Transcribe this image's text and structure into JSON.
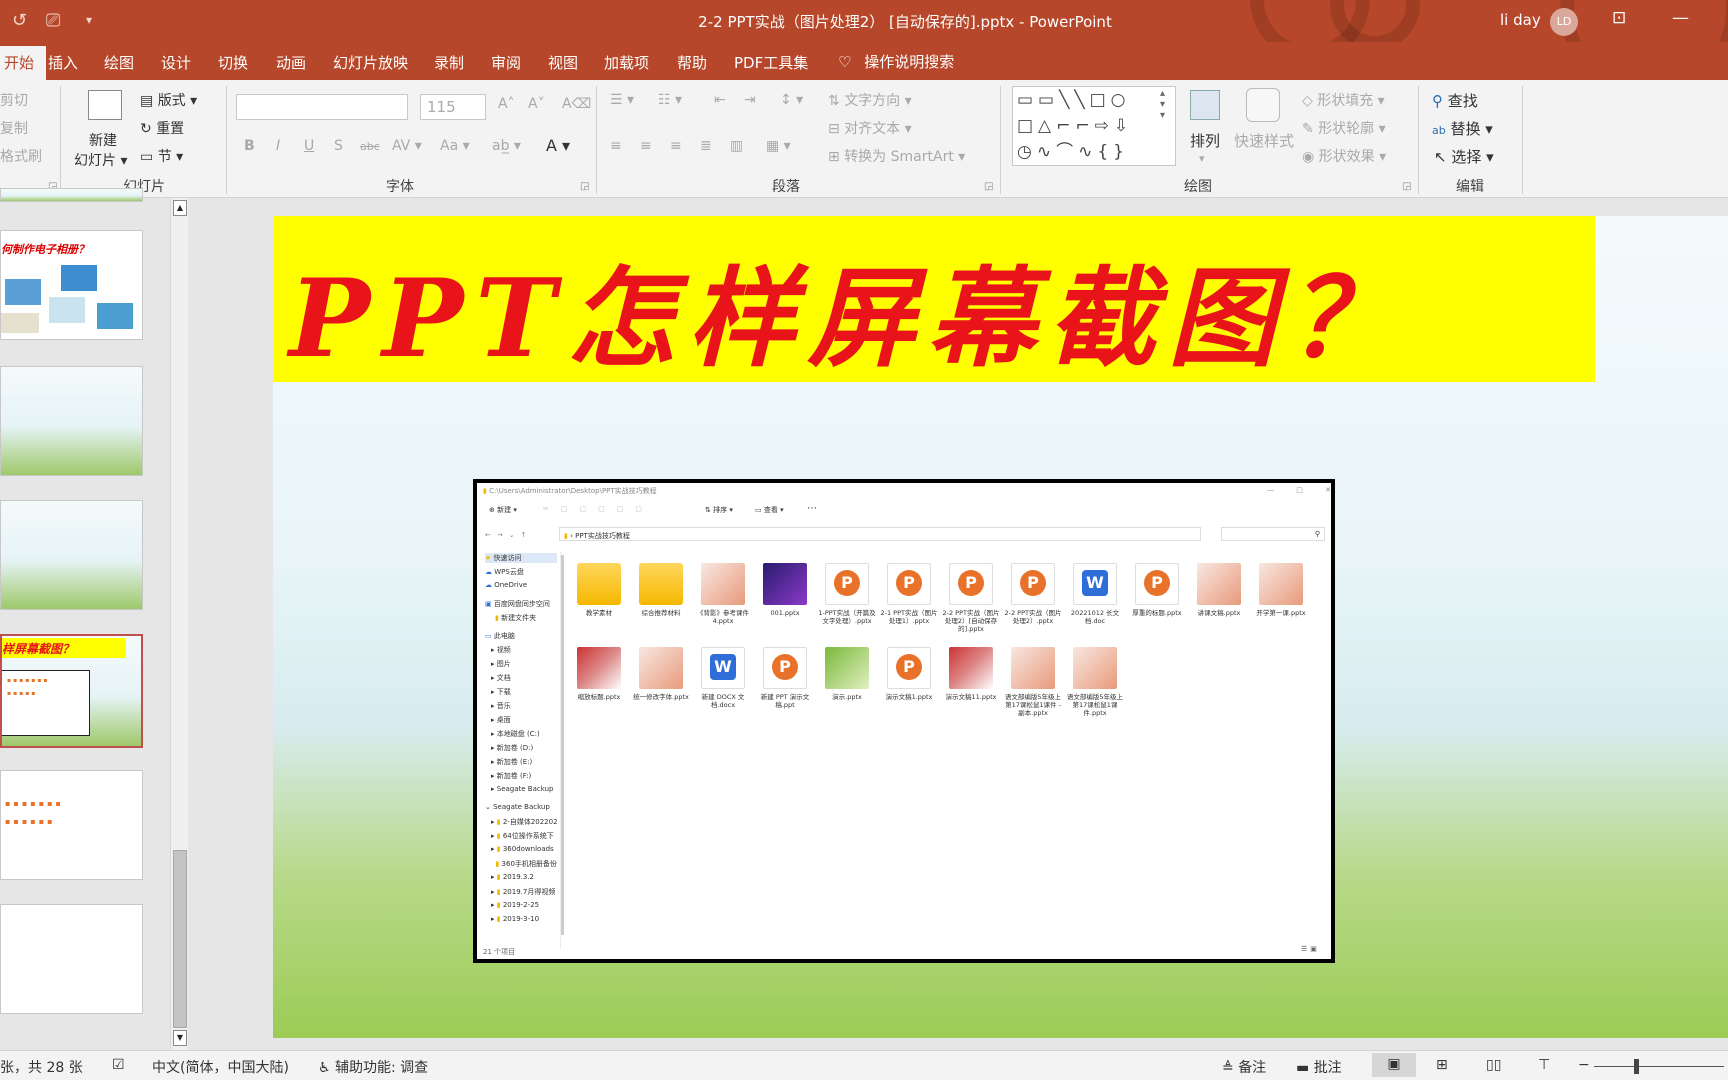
{
  "window": {
    "title": "2-2 PPT实战（图片处理2）  [自动保存的].pptx  -  PowerPoint",
    "user_name": "li day",
    "user_initials": "LD",
    "accent": "#b7472a"
  },
  "tabs": [
    "开始",
    "插入",
    "绘图",
    "设计",
    "切换",
    "动画",
    "幻灯片放映",
    "录制",
    "审阅",
    "视图",
    "加载项",
    "帮助",
    "PDF工具集"
  ],
  "tell_me": "操作说明搜索",
  "ribbon": {
    "clipboard": {
      "cut": "剪切",
      "copy": "复制",
      "format_painter": "格式刷"
    },
    "slides": {
      "new_slide_line1": "新建",
      "new_slide_line2": "幻灯片",
      "layout": "版式",
      "reset": "重置",
      "section": "节",
      "group": "幻灯片"
    },
    "font": {
      "size": "115",
      "group": "字体",
      "bold": "B",
      "italic": "I",
      "underline": "U",
      "shadow": "S",
      "strike": "abc",
      "spacing": "AV",
      "case": "Aa"
    },
    "paragraph": {
      "text_direction": "文字方向",
      "align_text": "对齐文本",
      "smartart": "转换为 SmartArt",
      "group": "段落"
    },
    "drawing": {
      "arrange": "排列",
      "quick_styles": "快速样式",
      "shape_fill": "形状填充",
      "shape_outline": "形状轮廓",
      "shape_effects": "形状效果",
      "group": "绘图"
    },
    "editing": {
      "find": "查找",
      "replace": "替换",
      "select": "选择",
      "group": "编辑"
    }
  },
  "thumbnails": [
    {
      "caption": "何制作电子相册？"
    },
    {
      "caption": ""
    },
    {
      "caption": ""
    },
    {
      "caption": "样屏幕截图？"
    },
    {
      "caption": ""
    },
    {
      "caption": ""
    }
  ],
  "slide": {
    "banner_text": "PPT怎样屏幕截图？",
    "explorer": {
      "title_path": "C:\\Users\\Administrator\\Desktop\\PPT实战技巧教程",
      "toolbar": {
        "new": "新建",
        "sort": "排序",
        "view": "查看"
      },
      "address": "PPT实战技巧教程",
      "sidebar": [
        "快速访问",
        "WPS云盘",
        "OneDrive",
        "百度网盘同步空间",
        "新建文件夹",
        "此电脑",
        "视频",
        "图片",
        "文档",
        "下载",
        "音乐",
        "桌面",
        "本地磁盘 (C:)",
        "新加卷 (D:)",
        "新加卷 (E:)",
        "新加卷 (F:)",
        "Seagate Backup",
        "Seagate Backup",
        "2-自媒体202202",
        "64位操作系统下",
        "360downloads",
        "360手机相册备份",
        "2019.3.2",
        "2019.7月得视频",
        "2019-2-25",
        "2019-3-10"
      ],
      "item_count": "21 个项目",
      "files_row1": [
        {
          "name": "教学素材",
          "kind": "folder"
        },
        {
          "name": "综合推荐材料",
          "kind": "folder"
        },
        {
          "name": "《背影》参考课件4.pptx",
          "kind": "img4"
        },
        {
          "name": "001.pptx",
          "kind": "img2"
        },
        {
          "name": "1-PPT实战（开篇及文字处理）.pptx",
          "kind": "ppt"
        },
        {
          "name": "2-1 PPT实战（图片处理1）.pptx",
          "kind": "ppt"
        },
        {
          "name": "2-2 PPT实战（图片处理2）[自动保存的].pptx",
          "kind": "ppt"
        },
        {
          "name": "2-2 PPT实战（图片处理2）.pptx",
          "kind": "ppt"
        },
        {
          "name": "20221012 长文档.doc",
          "kind": "word"
        },
        {
          "name": "厚重的标题.pptx",
          "kind": "ppt"
        },
        {
          "name": "讲课文稿.pptx",
          "kind": "img4"
        },
        {
          "name": "开学第一课.pptx",
          "kind": "img4"
        }
      ],
      "files_row2": [
        {
          "name": "缩放标题.pptx",
          "kind": "img"
        },
        {
          "name": "统一修改字体.pptx",
          "kind": "img4"
        },
        {
          "name": "新建 DOCX 文档.docx",
          "kind": "word"
        },
        {
          "name": "新建 PPT 演示文稿.ppt",
          "kind": "ppt"
        },
        {
          "name": "演示.pptx",
          "kind": "img3"
        },
        {
          "name": "演示文稿1.pptx",
          "kind": "ppt"
        },
        {
          "name": "演示文稿11.pptx",
          "kind": "img"
        },
        {
          "name": "语文部编版5年级上第17课松鼠1课件 - 副本.pptx",
          "kind": "img4"
        },
        {
          "name": "语文部编版5年级上第17课松鼠1课件.pptx",
          "kind": "img4"
        }
      ]
    }
  },
  "status": {
    "slide_info": "张，共 28 张",
    "language": "中文(简体，中国大陆)",
    "accessibility": "辅助功能: 调查",
    "notes": "备注",
    "comments": "批注"
  }
}
